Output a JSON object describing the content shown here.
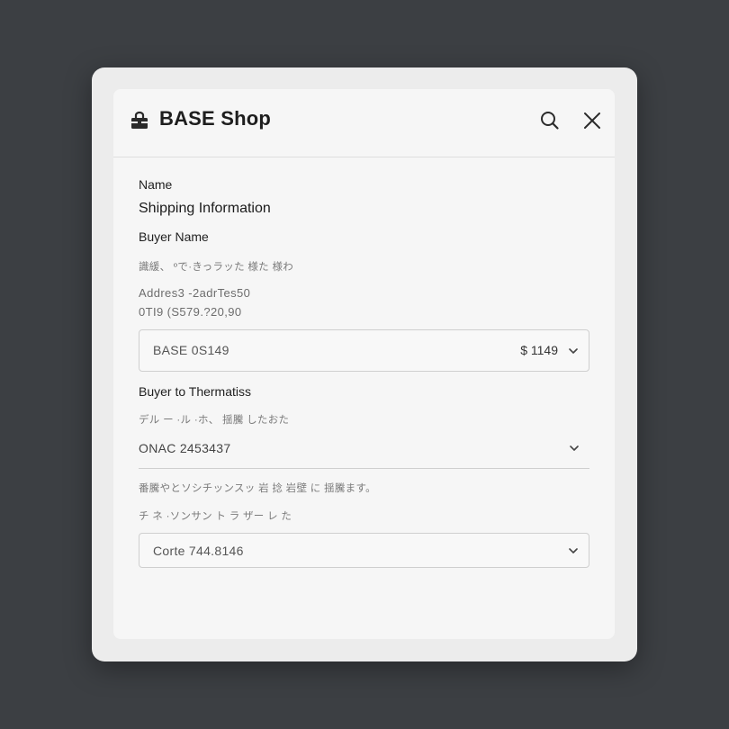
{
  "header": {
    "title": "BASE Shop",
    "icons": [
      "shop-icon",
      "search-icon",
      "close-icon"
    ]
  },
  "form": {
    "name_label": "Name",
    "section_title": "Shipping Information",
    "buyer_name_label": "Buyer Name",
    "buyer_name_note": "識緩、 ºで·きっラッた 様た 様わ",
    "address_line1": "Addres3 -2adrTes50",
    "address_line2": "0TI9 (S579.?20,90",
    "shipping_select": {
      "value": "BASE 0S149",
      "price": "$ 1149"
    },
    "buyer_to_label": "Buyer to Thermatiss",
    "buyer_to_note": "デル ー ·ル ·ホ、 揺騰 したおた",
    "order_select": {
      "value": "ONAC 2453437"
    },
    "info_note_1": "番騰やとソシチッンスッ 岩 捻 岩壁 に 揺騰ます。",
    "info_note_2": "チ ネ ·ソンサン ト ラ ザー レ た",
    "code_select": {
      "value": "Corte 744.8146"
    }
  }
}
